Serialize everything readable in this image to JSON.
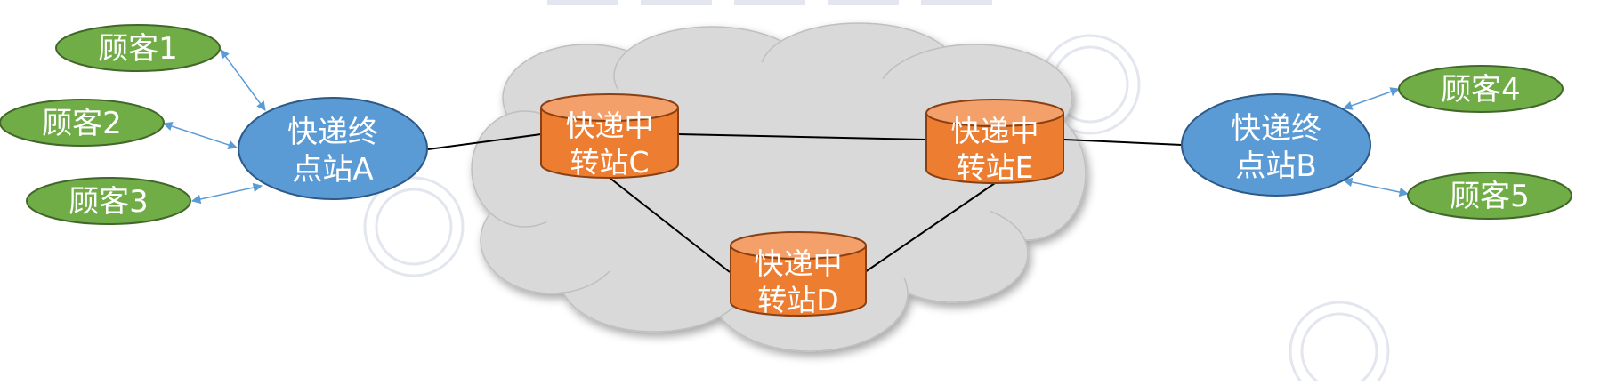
{
  "colors": {
    "customer_fill": "#70AD47",
    "customer_stroke": "#41672A",
    "terminal_fill": "#5B9BD5",
    "terminal_stroke": "#2E5A87",
    "hub_fill": "#ED7D31",
    "hub_stroke": "#8A4013",
    "cloud_fill": "#D9D9D9",
    "link": "#000000",
    "arrow": "#5B9BD5",
    "watermark": "#E3E6EF"
  },
  "customers": {
    "c1": "顾客1",
    "c2": "顾客2",
    "c3": "顾客3",
    "c4": "顾客4",
    "c5": "顾客5"
  },
  "terminals": {
    "a": {
      "line1": "快递终",
      "line2": "点站A"
    },
    "b": {
      "line1": "快递终",
      "line2": "点站B"
    }
  },
  "hubs": {
    "c": {
      "line1": "快递中",
      "line2": "转站C"
    },
    "d": {
      "line1": "快递中",
      "line2": "转站D"
    },
    "e": {
      "line1": "快递中",
      "line2": "转站E"
    }
  }
}
